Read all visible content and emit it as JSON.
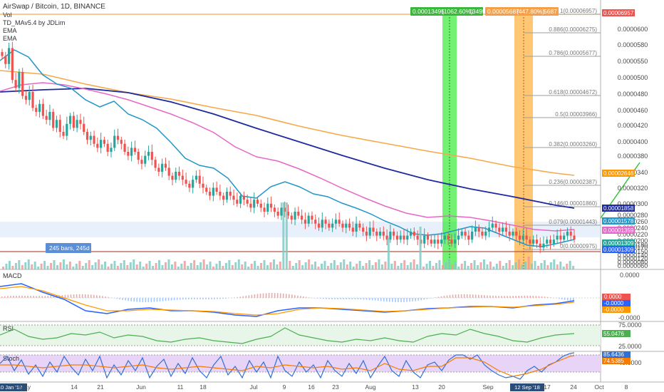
{
  "header": {
    "symbol_line": "AirSwap / Bitcoin, 1D, BINANCE",
    "indicators": [
      "Vol",
      "TD_MAv5.4 by JDLim",
      "EMA",
      "EMA"
    ]
  },
  "colors": {
    "up": "#26a69a",
    "down": "#ef5350",
    "green_zone": "#00e600",
    "orange_zone": "#ff9800",
    "ema_blue": "#1e2a9e",
    "ema_orange": "#f7a84a",
    "ema_pink": "#e667c7",
    "ema_teal": "#2196c9",
    "rsi_line": "#4caf50",
    "stoch_k": "#2f6fd6",
    "stoch_d": "#f57c00"
  },
  "measure_boxes": {
    "green": {
      "value": "0.00013495",
      "pct": "(1062.60%)",
      "bars": "13495"
    },
    "orange": {
      "value": "0.00005687",
      "pct": "(447.80%)",
      "bars": "5687"
    }
  },
  "range_label": "245 bars, 245d",
  "fib_levels": [
    {
      "ratio": "1",
      "price": "0.00006957",
      "label": "1(0.00006957)"
    },
    {
      "ratio": "0.886",
      "price": "0.00006275",
      "label": "0.886(0.00006275)"
    },
    {
      "ratio": "0.786",
      "price": "0.00005677",
      "label": "0.786(0.00005677)"
    },
    {
      "ratio": "0.618",
      "price": "0.00004672",
      "label": "0.618(0.00004672)"
    },
    {
      "ratio": "0.5",
      "price": "0.00003966",
      "label": "0.5(0.00003966)"
    },
    {
      "ratio": "0.382",
      "price": "0.00003260",
      "label": "0.382(0.00003260)"
    },
    {
      "ratio": "0.236",
      "price": "0.00002387",
      "label": "0.236(0.00002387)"
    },
    {
      "ratio": "0.146",
      "price": "0.00001860",
      "label": "0.146(0.00001860)"
    },
    {
      "ratio": "0.079",
      "price": "0.00001443",
      "label": "0.079(0.00001443)"
    },
    {
      "ratio": "0",
      "price": "0.00000975",
      "label": "0(0.00000975)"
    }
  ],
  "right_axis": {
    "ticks": [
      "0.0000600",
      "0.0000580",
      "0.0000550",
      "0.0000500",
      "0.0000480",
      "0.0000460",
      "0.0000420",
      "0.0000400",
      "0.0000380",
      "0.0000340",
      "0.0000320",
      "0.0000300",
      "0.0000280",
      "0.0000260",
      "0.0000240",
      "0.0000220",
      "0.0000200",
      "0.0000180",
      "0.0000170",
      "0.0000150",
      "0.0000140",
      "0.0000120",
      "0.0000080",
      "0.0000060"
    ],
    "tags": [
      {
        "text": "0.00006957",
        "color": "#ef5350"
      },
      {
        "text": "0.00002646",
        "color": "#ff9800"
      },
      {
        "text": "0.00001858",
        "color": "#1e2a9e"
      },
      {
        "text": "0.00001578",
        "color": "#2196c9"
      },
      {
        "text": "0.00001359",
        "color": "#e667c7"
      },
      {
        "text": "0.00001309",
        "color": "#26a69a"
      },
      {
        "text": "0.00001309",
        "color": "#2962ff"
      }
    ]
  },
  "macd": {
    "title": "MACD",
    "axis": [
      "0.0000",
      "-0.0000"
    ],
    "tags": [
      {
        "text": "0.0000",
        "color": "#ef5350"
      },
      {
        "text": "-0.0000",
        "color": "#2962ff"
      },
      {
        "text": "-0.0000",
        "color": "#ff9800"
      }
    ]
  },
  "rsi": {
    "title": "RSI",
    "axis": [
      "75.0000",
      "25.0000"
    ],
    "tag": "55.0476"
  },
  "stoch": {
    "title": "Stoch",
    "axis": [
      "40.0000"
    ],
    "tags": [
      "85.6436",
      "74.5385"
    ]
  },
  "x_axis": {
    "labels": [
      "10 Jan '18",
      "May",
      "14",
      "21",
      "Jun",
      "11",
      "18",
      "Jul",
      "9",
      "16",
      "23",
      "Aug",
      "13",
      "20",
      "Sep",
      "12 Sep '18",
      "17",
      "24",
      "Oct",
      "8"
    ],
    "highlight_start": "10 Jan '18",
    "highlight_date": "12 Sep '18"
  },
  "chart_data": {
    "type": "candlestick",
    "title": "AirSwap / Bitcoin, 1D, BINANCE",
    "description_series": [
      "price",
      "EMA fast",
      "EMA slow",
      "EMA 200",
      "EMA 100",
      "Volume",
      "MACD",
      "RSI",
      "Stoch"
    ],
    "price_range": [
      6e-06,
      7e-05
    ],
    "close": [
      58,
      56,
      60,
      52,
      50,
      54,
      48,
      47,
      49,
      45,
      44,
      46,
      43,
      42,
      44,
      40,
      42,
      39,
      38,
      41,
      43,
      40,
      42,
      41,
      39,
      37,
      38,
      36,
      35,
      37,
      36,
      34,
      35,
      38,
      37,
      36,
      34,
      33,
      35,
      34,
      32,
      31,
      33,
      34,
      32,
      30,
      29,
      31,
      30,
      28,
      27,
      29,
      28,
      27,
      26,
      25,
      27,
      28,
      26,
      25,
      24,
      23,
      25,
      24,
      23,
      22,
      24,
      23,
      22,
      21,
      23,
      22,
      21,
      20,
      22,
      21,
      20,
      19,
      21,
      20,
      19,
      18,
      20,
      19,
      18,
      17,
      19,
      18,
      17,
      16,
      18,
      17,
      16,
      15,
      17,
      16,
      15,
      16,
      17,
      16,
      15,
      16,
      15,
      14,
      16,
      15,
      14,
      13,
      15,
      14,
      13,
      14,
      13,
      12,
      14,
      13,
      12,
      13,
      12,
      13,
      14,
      13,
      12,
      11,
      13,
      12,
      11,
      12,
      11,
      12,
      13,
      12,
      11,
      12,
      13,
      14,
      13,
      12,
      14,
      15,
      14,
      13,
      14,
      15,
      16,
      15,
      14,
      15,
      14,
      13,
      14,
      13,
      12,
      13,
      12,
      11,
      12,
      11,
      10,
      11,
      12,
      11,
      12,
      13,
      12,
      13,
      14,
      13,
      12
    ],
    "ema_blue": [
      46,
      45,
      45,
      44,
      44,
      43,
      43,
      42,
      42,
      41,
      41,
      40,
      40,
      39,
      39,
      38,
      38,
      37,
      37,
      36,
      36,
      35,
      35,
      34,
      34,
      33,
      33,
      32,
      32,
      31,
      30,
      30,
      29,
      29,
      28,
      28,
      27,
      27,
      26,
      26,
      25,
      25,
      24,
      24,
      23,
      23,
      22,
      22,
      21,
      21,
      20,
      20,
      19,
      19,
      18.5,
      18,
      17.5,
      17,
      16.8,
      16.5,
      16.2,
      16
    ],
    "ema_orange": [
      60,
      59.5,
      59,
      58.5,
      58,
      57.5,
      57,
      56.5,
      56,
      55.5,
      55,
      54.5,
      54,
      53.5,
      53,
      52.5,
      52,
      51.5,
      51,
      50.5,
      50,
      49.5,
      49,
      48.5,
      48,
      47.5,
      47,
      46.5,
      46,
      45.5,
      45,
      44.5,
      44,
      43.5,
      43,
      42.5,
      42,
      41.5,
      41,
      40.5,
      40,
      39.5,
      39,
      38.5,
      38,
      37.5,
      37,
      36.5,
      36,
      35.5,
      35,
      34.5,
      34,
      33.5,
      33,
      32.5,
      32,
      31.5,
      31,
      30.5
    ],
    "rsi_value": 55.0476,
    "stoch_values": [
      85.6436,
      74.5385
    ]
  }
}
